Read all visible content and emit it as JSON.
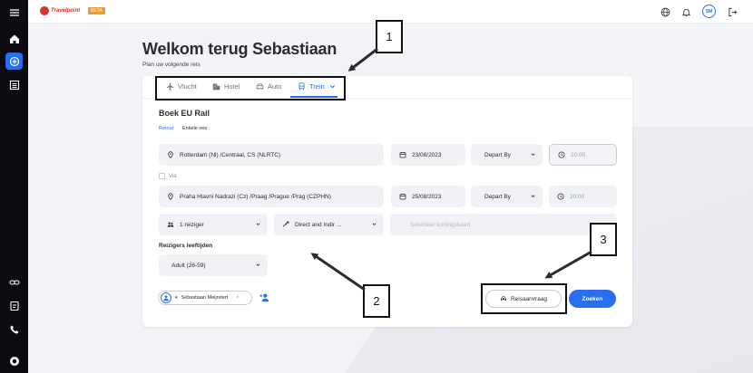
{
  "brand": {
    "logo_text": "Travelpoint",
    "beta_label": "BETA"
  },
  "topbar": {
    "avatar_initials": "SM"
  },
  "greeting": {
    "title": "Welkom terug Sebastiaan",
    "subtitle": "Plan uw volgende reis"
  },
  "tabs": [
    {
      "label": "Vlucht",
      "icon": "plane-icon"
    },
    {
      "label": "Hotel",
      "icon": "hotel-icon"
    },
    {
      "label": "Auto",
      "icon": "car-icon"
    },
    {
      "label": "Trein",
      "icon": "train-icon",
      "active": true
    }
  ],
  "booking": {
    "section_title": "Boek EU Rail",
    "trip_types": [
      "Retour",
      "Enkele reis"
    ],
    "outbound": {
      "from": "Rotterdam (Nl) /Centraal, CS (NLRTC)",
      "date": "23/08/2023",
      "depart_mode": "Depart By",
      "time": "20:00"
    },
    "via_label": "Via",
    "return": {
      "to": "Praha Hlavni Nadrazi (Cz) /Praag /Prague /Prag (CZPHN)",
      "date": "25/08/2023",
      "depart_mode": "Depart By",
      "time": "20:00"
    },
    "travellers": "1 reiziger",
    "connection": "Direct and Indir ...",
    "discount_card_placeholder": "Selecteer kortingskaart",
    "ages_title": "Reizigers leeftijden",
    "age_group": "Adult (26-59)",
    "traveller_chip": "Sebastiaan Meijndert",
    "travel_request_label": "Reisaanvraag",
    "search_label": "Zoeken"
  },
  "annotations": [
    "1",
    "2",
    "3"
  ],
  "colors": {
    "accent": "#2a6ef0",
    "sidebar": "#0c0c10",
    "brand": "#d9342b",
    "beta": "#f39a2d"
  }
}
